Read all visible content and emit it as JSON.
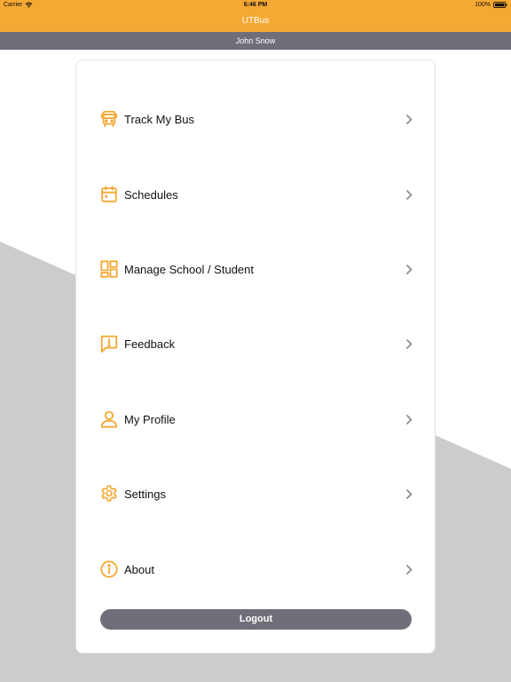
{
  "status_bar": {
    "carrier": "Carrier",
    "time": "6:46 PM",
    "battery": "100%"
  },
  "nav": {
    "title": "UTBus"
  },
  "user": {
    "name": "John Snow"
  },
  "menu": {
    "items": [
      {
        "label": "Track My Bus",
        "icon": "bus-icon"
      },
      {
        "label": "Schedules",
        "icon": "calendar-icon"
      },
      {
        "label": "Manage School / Student",
        "icon": "dashboard-icon"
      },
      {
        "label": "Feedback",
        "icon": "feedback-icon"
      },
      {
        "label": "My Profile",
        "icon": "user-icon"
      },
      {
        "label": "Settings",
        "icon": "gear-icon"
      },
      {
        "label": "About",
        "icon": "info-icon"
      }
    ]
  },
  "logout_label": "Logout",
  "colors": {
    "accent": "#f5a833",
    "header_gray": "#6e6f79",
    "background_gray": "#cccccc",
    "chevron": "#8a8a8a"
  }
}
